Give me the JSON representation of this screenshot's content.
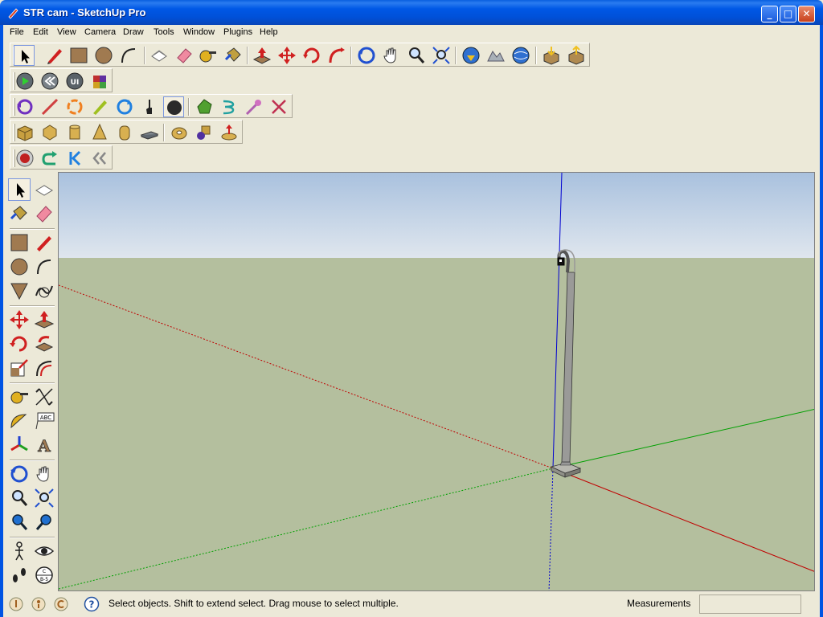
{
  "window": {
    "title": "STR cam - SketchUp Pro",
    "minimize_glyph": "_",
    "maximize_glyph": "□",
    "close_glyph": "✕"
  },
  "menu": [
    "File",
    "Edit",
    "View",
    "Camera",
    "Draw",
    "Tools",
    "Window",
    "Plugins",
    "Help"
  ],
  "status": {
    "hint": "Select objects. Shift to extend select. Drag mouse to select multiple.",
    "measurements_label": "Measurements",
    "measurements_value": ""
  },
  "colors": {
    "sky_top": "#a9c1de",
    "sky_bottom": "#dfe6ee",
    "ground": "#b4bf9e",
    "axis_red": "#c00000",
    "axis_green": "#00a000",
    "axis_blue": "#0000d0"
  }
}
